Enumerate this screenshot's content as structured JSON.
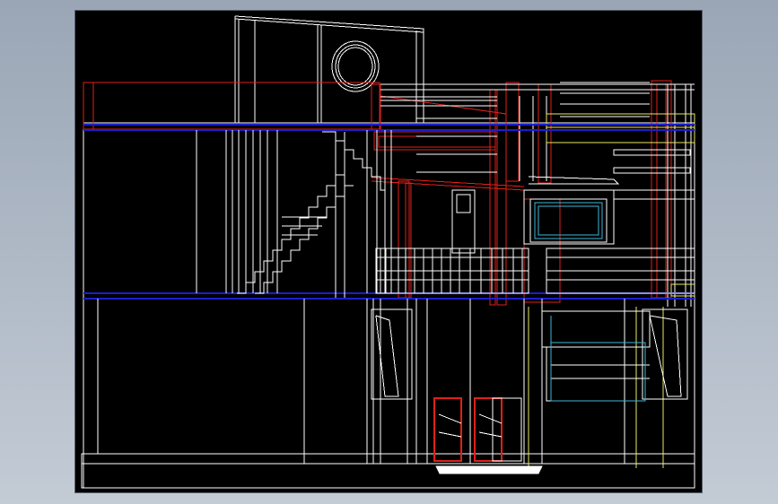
{
  "drawing": {
    "type": "cad-elevation-wireframe",
    "background": "#000000",
    "colors": {
      "outline": "#ffffff",
      "wall": "#e0201a",
      "floor_line": "#1e1ecc",
      "glass": "#3fb6d6",
      "detail": "#e8e866",
      "trim": "#ffb0b0",
      "ground_fill": "#ffffff"
    }
  }
}
